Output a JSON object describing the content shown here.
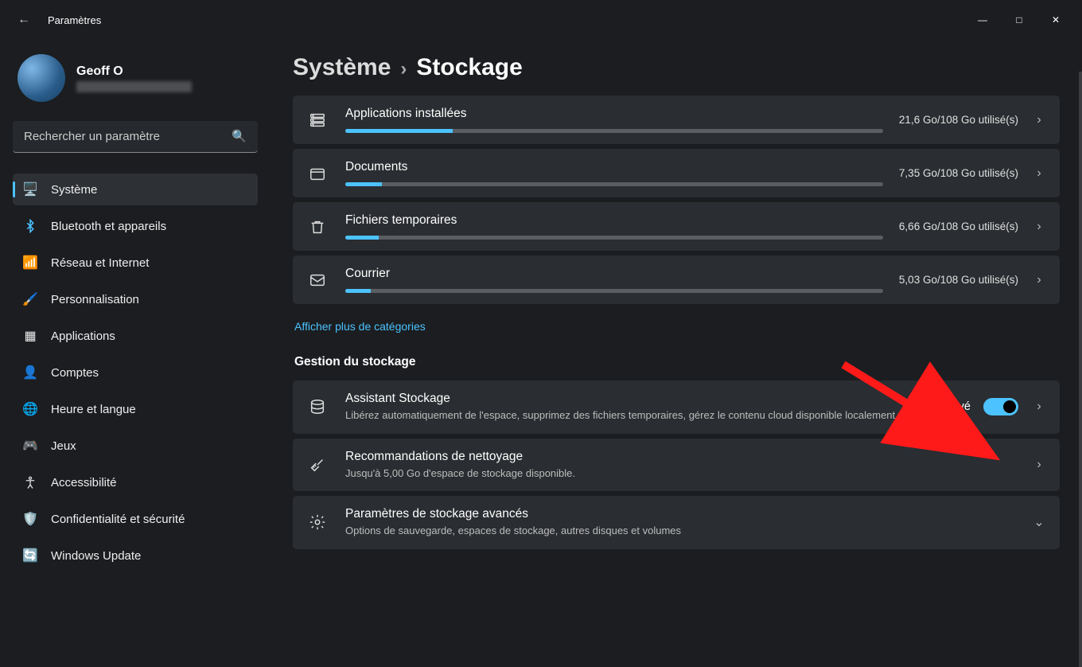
{
  "app": {
    "title": "Paramètres"
  },
  "user": {
    "name": "Geoff O"
  },
  "search": {
    "placeholder": "Rechercher un paramètre"
  },
  "nav": {
    "items": [
      {
        "label": "Système",
        "icon": "🖥️",
        "active": true
      },
      {
        "label": "Bluetooth et appareils",
        "icon": "bt"
      },
      {
        "label": "Réseau et Internet",
        "icon": "📶"
      },
      {
        "label": "Personnalisation",
        "icon": "🖌️"
      },
      {
        "label": "Applications",
        "icon": "▦"
      },
      {
        "label": "Comptes",
        "icon": "👤"
      },
      {
        "label": "Heure et langue",
        "icon": "🌐"
      },
      {
        "label": "Jeux",
        "icon": "🎮"
      },
      {
        "label": "Accessibilité",
        "icon": "acc"
      },
      {
        "label": "Confidentialité et sécurité",
        "icon": "🛡️"
      },
      {
        "label": "Windows Update",
        "icon": "🔄"
      }
    ]
  },
  "breadcrumb": {
    "parent": "Système",
    "current": "Stockage"
  },
  "storage": {
    "items": [
      {
        "title": "Applications installées",
        "usage": "21,6 Go/108 Go utilisé(s)",
        "pct": 20
      },
      {
        "title": "Documents",
        "usage": "7,35 Go/108 Go utilisé(s)",
        "pct": 6.8
      },
      {
        "title": "Fichiers temporaires",
        "usage": "6,66 Go/108 Go utilisé(s)",
        "pct": 6.2
      },
      {
        "title": "Courrier",
        "usage": "5,03 Go/108 Go utilisé(s)",
        "pct": 4.7
      }
    ],
    "more_link": "Afficher plus de catégories"
  },
  "management": {
    "heading": "Gestion du stockage",
    "sense": {
      "title": "Assistant Stockage",
      "desc": "Libérez automatiquement de l'espace, supprimez des fichiers temporaires, gérez le contenu cloud disponible localement.",
      "state_label": "Activé",
      "on": true
    },
    "cleanup": {
      "title": "Recommandations de nettoyage",
      "desc": "Jusqu'à 5,00 Go d'espace de stockage disponible."
    },
    "advanced": {
      "title": "Paramètres de stockage avancés",
      "desc": "Options de sauvegarde, espaces de stockage, autres disques et volumes"
    }
  }
}
